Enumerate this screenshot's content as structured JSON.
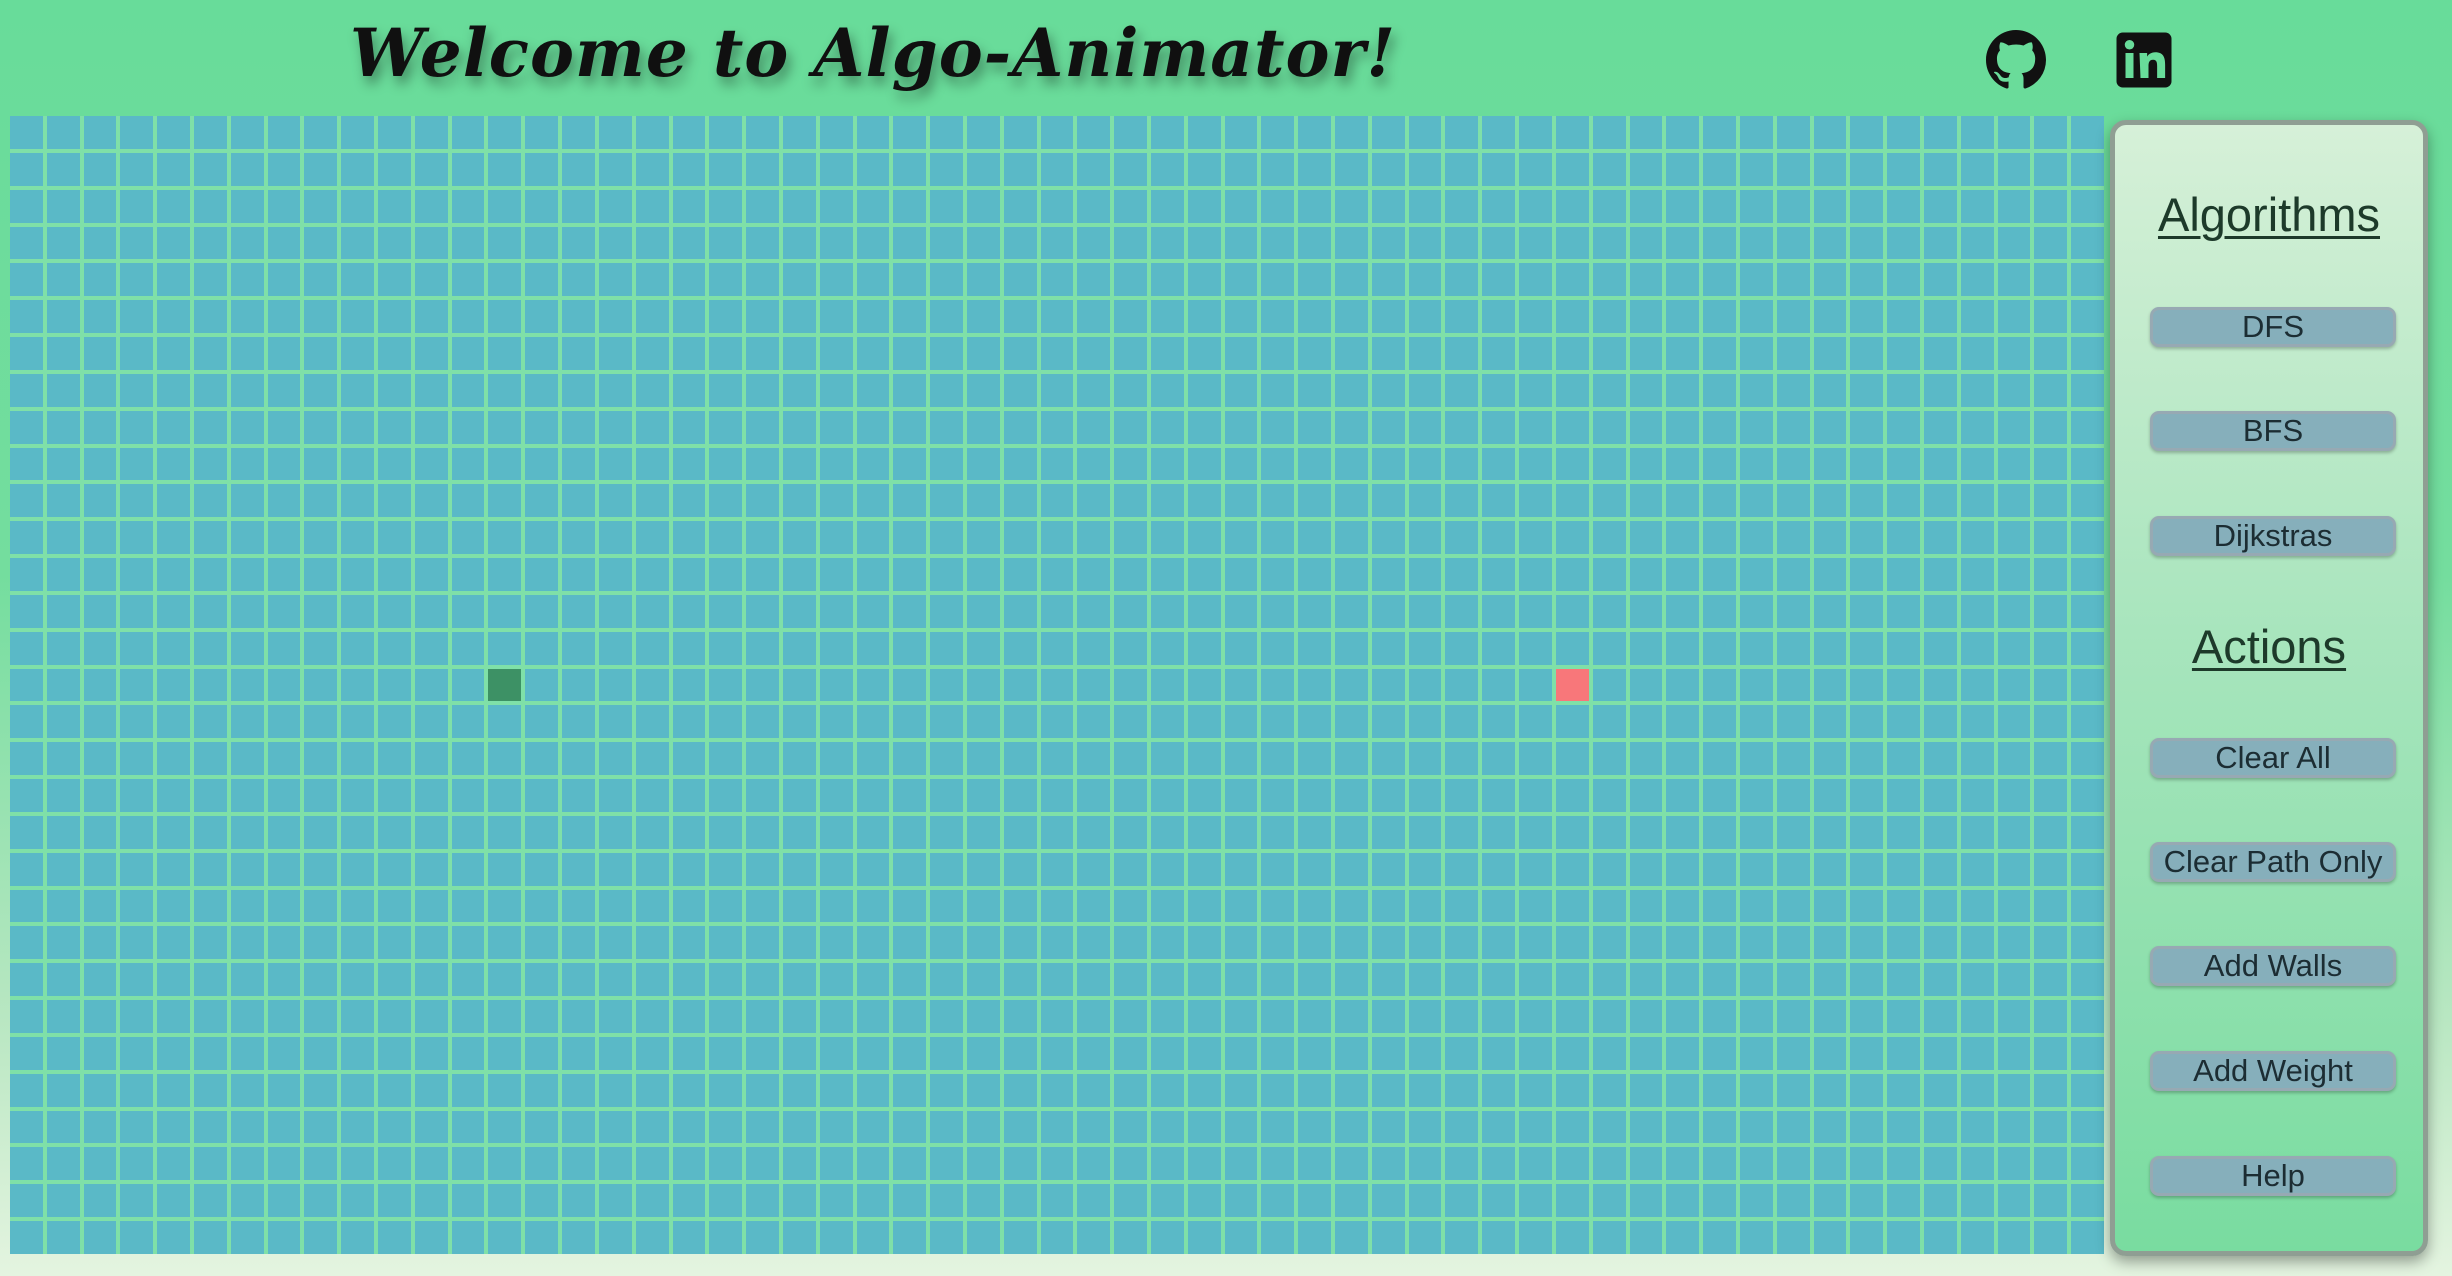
{
  "header": {
    "title": "Welcome to Algo-Animator!",
    "links": [
      {
        "name": "github",
        "icon": "github-icon"
      },
      {
        "name": "linkedin",
        "icon": "linkedin-icon"
      }
    ]
  },
  "grid": {
    "rows": 31,
    "cols": 57,
    "start": {
      "row": 15,
      "col": 13
    },
    "end": {
      "row": 15,
      "col": 42
    },
    "colors": {
      "cell": "#5ab9c7",
      "start": "#3d9165",
      "end": "#f8777a",
      "gridline": "#7fe0a8"
    }
  },
  "panel": {
    "algorithms_heading": "Algorithms",
    "algorithms": [
      "DFS",
      "BFS",
      "Dijkstras"
    ],
    "actions_heading": "Actions",
    "actions": [
      "Clear All",
      "Clear Path Only",
      "Add Walls",
      "Add Weight",
      "Help"
    ]
  }
}
